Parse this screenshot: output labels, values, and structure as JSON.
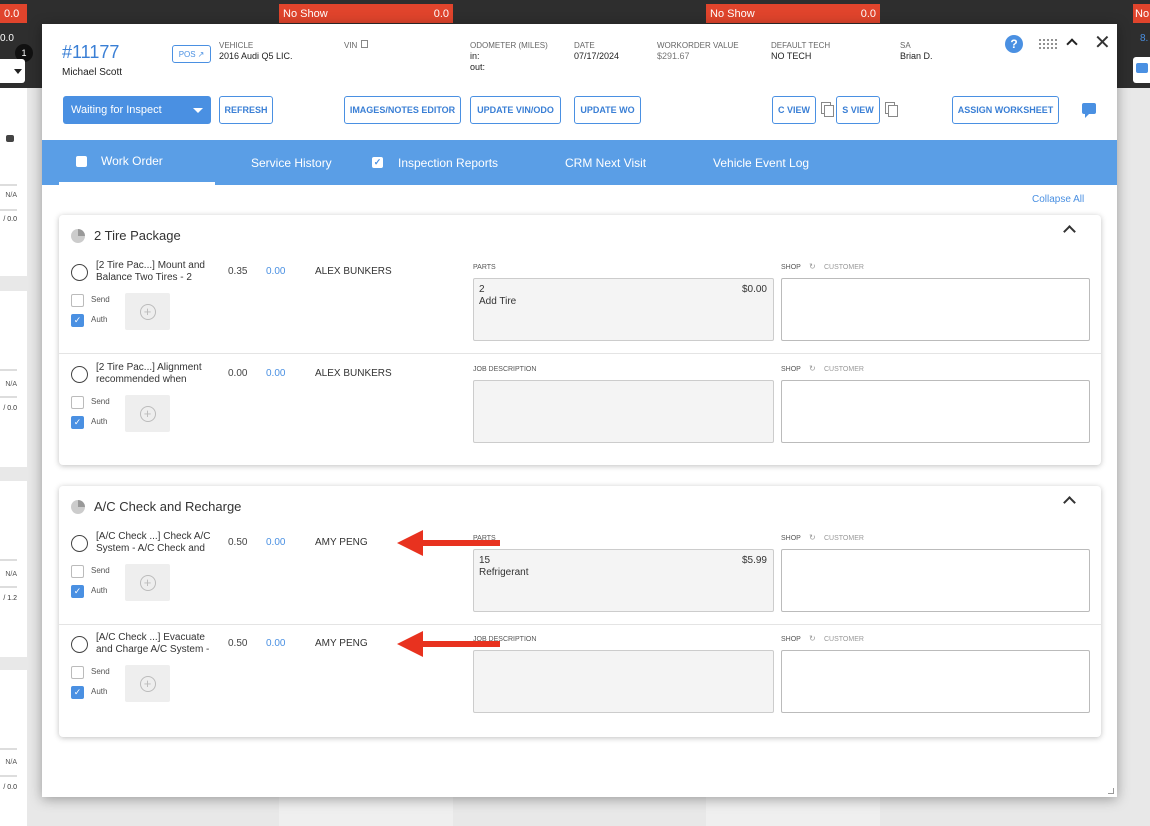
{
  "background": {
    "badges": [
      {
        "label": "0.0",
        "value": ""
      },
      {
        "label": "No Show",
        "value": "0.0"
      },
      {
        "label": "No Show",
        "value": "0.0"
      },
      {
        "label": "No",
        "value": ""
      }
    ],
    "left_value": "0.0",
    "notification_count": "1",
    "right_value": "8.",
    "left_cards": [
      {
        "na": "N/A",
        "val": "/ 0.0"
      },
      {
        "na": "N/A",
        "val": "/ 0.0"
      },
      {
        "na": "N/A",
        "val": "/ 1.2"
      },
      {
        "na": "N/A",
        "val": "/ 0.0"
      }
    ]
  },
  "header": {
    "wo_number": "#11177",
    "customer_name": "Michael Scott",
    "pos_label": "POS",
    "vehicle_label": "VEHICLE",
    "vehicle_value": "2016 Audi Q5 LIC.",
    "vin_label": "VIN",
    "odometer_label": "ODOMETER (MILES)",
    "odometer_in": "in:",
    "odometer_out": "out:",
    "date_label": "DATE",
    "date_value": "07/17/2024",
    "wo_value_label": "WORKORDER VALUE",
    "wo_value": "$291.67",
    "tech_label": "DEFAULT TECH",
    "tech_value": "NO TECH",
    "sa_label": "SA",
    "sa_value": "Brian D."
  },
  "toolbar": {
    "status": "Waiting for Inspect",
    "refresh": "REFRESH",
    "images_notes": "IMAGES/NOTES EDITOR",
    "update_vin": "UPDATE VIN/ODO",
    "update_wo": "UPDATE WO",
    "c_view": "C VIEW",
    "s_view": "S VIEW",
    "assign_worksheet": "ASSIGN WORKSHEET"
  },
  "tabs": [
    {
      "label": "Work Order",
      "checked": false
    },
    {
      "label": "Service History"
    },
    {
      "label": "Inspection Reports",
      "checked": true
    },
    {
      "label": "CRM Next Visit"
    },
    {
      "label": "Vehicle Event Log"
    }
  ],
  "collapse_all": "Collapse All",
  "labels": {
    "send": "Send",
    "auth": "Auth",
    "parts": "PARTS",
    "job_description": "JOB DESCRIPTION",
    "shop": "SHOP",
    "customer": "CUSTOMER"
  },
  "sections": [
    {
      "title": "2 Tire Package",
      "jobs": [
        {
          "name": "[2 Tire Pac...] Mount and Balance Two Tires - 2",
          "hours": "0.35",
          "cost": "0.00",
          "tech": "ALEX BUNKERS",
          "box_type": "parts",
          "qty": "2",
          "part": "Add Tire",
          "price": "$0.00"
        },
        {
          "name": "[2 Tire Pac...] Alignment recommended when",
          "hours": "0.00",
          "cost": "0.00",
          "tech": "ALEX BUNKERS",
          "box_type": "job_description"
        }
      ]
    },
    {
      "title": "A/C Check and Recharge",
      "jobs": [
        {
          "name": "[A/C Check ...] Check A/C System - A/C Check and",
          "hours": "0.50",
          "cost": "0.00",
          "tech": "AMY PENG",
          "box_type": "parts",
          "qty": "15",
          "part": "Refrigerant",
          "price": "$5.99"
        },
        {
          "name": "[A/C Check ...] Evacuate and Charge A/C System -",
          "hours": "0.50",
          "cost": "0.00",
          "tech": "AMY PENG",
          "box_type": "job_description"
        }
      ]
    }
  ],
  "colors": {
    "accent": "#4a90e2",
    "badge_red": "#e0442c",
    "arrow_red": "#e8321f"
  }
}
